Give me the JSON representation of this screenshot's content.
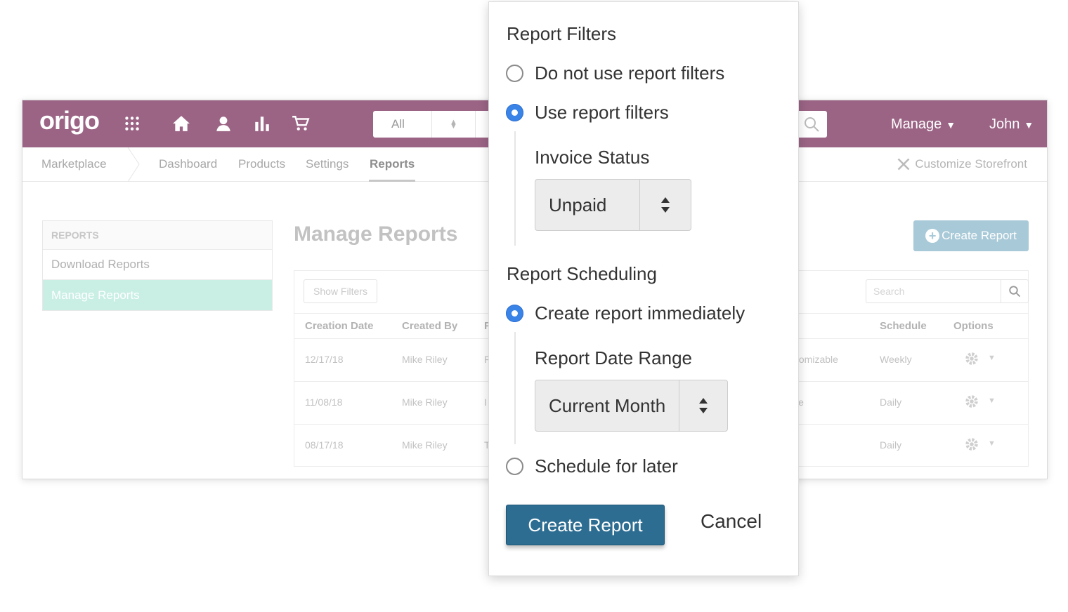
{
  "app": {
    "logo": "origo",
    "search_scope": "All",
    "menu": {
      "manage": "Manage",
      "user": "John"
    },
    "subnav": {
      "items": [
        "Marketplace",
        "Dashboard",
        "Products",
        "Settings",
        "Reports"
      ],
      "customize": "Customize Storefront"
    },
    "sidebar": {
      "header": "REPORTS",
      "items": [
        "Download Reports",
        "Manage Reports"
      ]
    },
    "main": {
      "title": "Manage Reports",
      "create_button": "Create Report",
      "show_filters": "Show Filters",
      "search_placeholder": "Search",
      "columns": [
        "Creation Date",
        "Created By",
        "F",
        "Schedule",
        "Options"
      ],
      "rows": [
        {
          "date": "12/17/18",
          "by": "Mike Riley",
          "f": "F",
          "name": "tomizable",
          "schedule": "Weekly"
        },
        {
          "date": "11/08/18",
          "by": "Mike Riley",
          "f": "I",
          "name": "le",
          "schedule": "Daily"
        },
        {
          "date": "08/17/18",
          "by": "Mike Riley",
          "f": "T",
          "name": "",
          "schedule": "Daily"
        }
      ]
    }
  },
  "modal": {
    "filters_title": "Report Filters",
    "filter_off": "Do not use report filters",
    "filter_on": "Use report filters",
    "invoice_status_label": "Invoice Status",
    "invoice_status_value": "Unpaid",
    "scheduling_title": "Report Scheduling",
    "schedule_now": "Create report immediately",
    "date_range_label": "Report Date Range",
    "date_range_value": "Current Month",
    "schedule_later": "Schedule for later",
    "create_button": "Create Report",
    "cancel_button": "Cancel",
    "selected_filter": "Use report filters",
    "selected_schedule": "Create report immediately"
  },
  "colors": {
    "brand": "#9b6485",
    "accent": "#6fd3d0",
    "primary_button": "#2d6d92",
    "radio_selected": "#3a84e8",
    "sidebar_active": "#c9efe5"
  }
}
